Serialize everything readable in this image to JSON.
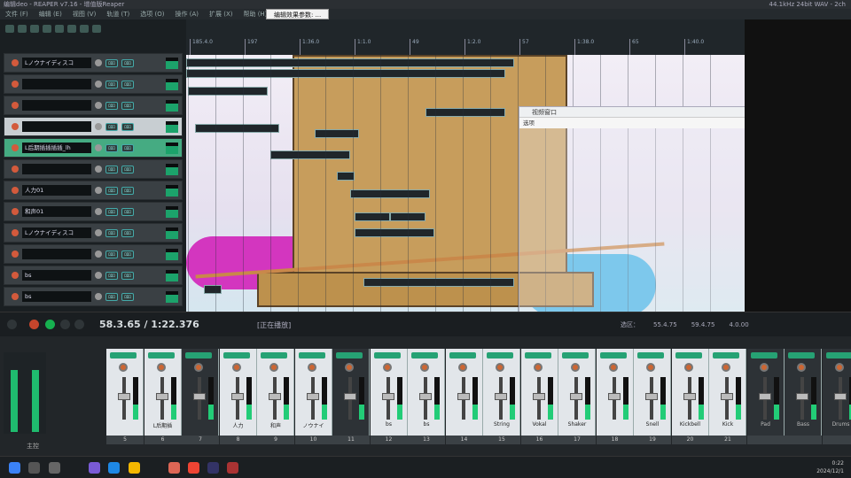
{
  "window": {
    "title": "编辑deo - REAPER v7.16 - 增值版Reaper",
    "info": "44.1kHz 24bit WAV - 2ch"
  },
  "menu": [
    "文件 (F)",
    "编辑 (E)",
    "视图 (V)",
    "轨道 (T)",
    "选项 (O)",
    "操作 (A)",
    "扩展 (X)",
    "帮助 (H)"
  ],
  "fx_window_title": "编辑效果参数: ...",
  "tracks": [
    {
      "name": "Lノウナイディスコ",
      "selected": false,
      "folder": false
    },
    {
      "name": "",
      "selected": false,
      "folder": false
    },
    {
      "name": "",
      "selected": false,
      "folder": false
    },
    {
      "name": "",
      "selected": true,
      "folder": false
    },
    {
      "name": "L后期插插插插_lh",
      "selected": false,
      "folder": true
    },
    {
      "name": "",
      "selected": false,
      "folder": false
    },
    {
      "name": "人力01",
      "selected": false,
      "folder": false
    },
    {
      "name": "和声01",
      "selected": false,
      "folder": false
    },
    {
      "name": "Lノウナイディスコ",
      "selected": false,
      "folder": false
    },
    {
      "name": "",
      "selected": false,
      "folder": false
    },
    {
      "name": "bs",
      "selected": false,
      "folder": false
    },
    {
      "name": "bs",
      "selected": false,
      "folder": false
    }
  ],
  "track_button_label": "ﾛﾛﾛ",
  "ruler_ticks": [
    "185.4.0",
    "197",
    "1:36.0",
    "1:1.0",
    "49",
    "1:2.0",
    "57",
    "1:38.0",
    "65",
    "1:40.0"
  ],
  "video_window": {
    "title": "视频窗口",
    "subtitle": "选项"
  },
  "transport": {
    "position": "58.3.65 / 1:22.376",
    "status": "[正在播放]",
    "selection_label": "选区：",
    "sel_start": "55.4.75",
    "sel_end": "59.4.75",
    "sel_len": "4.0.00"
  },
  "mixer": {
    "strips": [
      {
        "label": "",
        "number": "5",
        "dark": false
      },
      {
        "label": "L后期插",
        "number": "6",
        "dark": false
      },
      {
        "label": "",
        "number": "7",
        "dark": true
      },
      {
        "label": "人力",
        "number": "8",
        "dark": false
      },
      {
        "label": "和声",
        "number": "9",
        "dark": false
      },
      {
        "label": "ノウナイ",
        "number": "10",
        "dark": false
      },
      {
        "label": "",
        "number": "11",
        "dark": true
      },
      {
        "label": "bs",
        "number": "12",
        "dark": false
      },
      {
        "label": "bs",
        "number": "13",
        "dark": false
      },
      {
        "label": "",
        "number": "14",
        "dark": false
      },
      {
        "label": "String",
        "number": "15",
        "dark": false
      },
      {
        "label": "Vokal",
        "number": "16",
        "dark": false
      },
      {
        "label": "Shaker",
        "number": "17",
        "dark": false
      },
      {
        "label": "",
        "number": "18",
        "dark": false
      },
      {
        "label": "Snell",
        "number": "19",
        "dark": false
      },
      {
        "label": "Kickbell",
        "number": "20",
        "dark": false
      },
      {
        "label": "Kick",
        "number": "21",
        "dark": false
      },
      {
        "label": "Pad",
        "number": "",
        "dark": true
      },
      {
        "label": "Bass",
        "number": "",
        "dark": true
      },
      {
        "label": "Drums",
        "number": "",
        "dark": true
      }
    ],
    "master_label": "主控"
  },
  "clock": {
    "time": "0:22",
    "date": "2024/12/1"
  }
}
